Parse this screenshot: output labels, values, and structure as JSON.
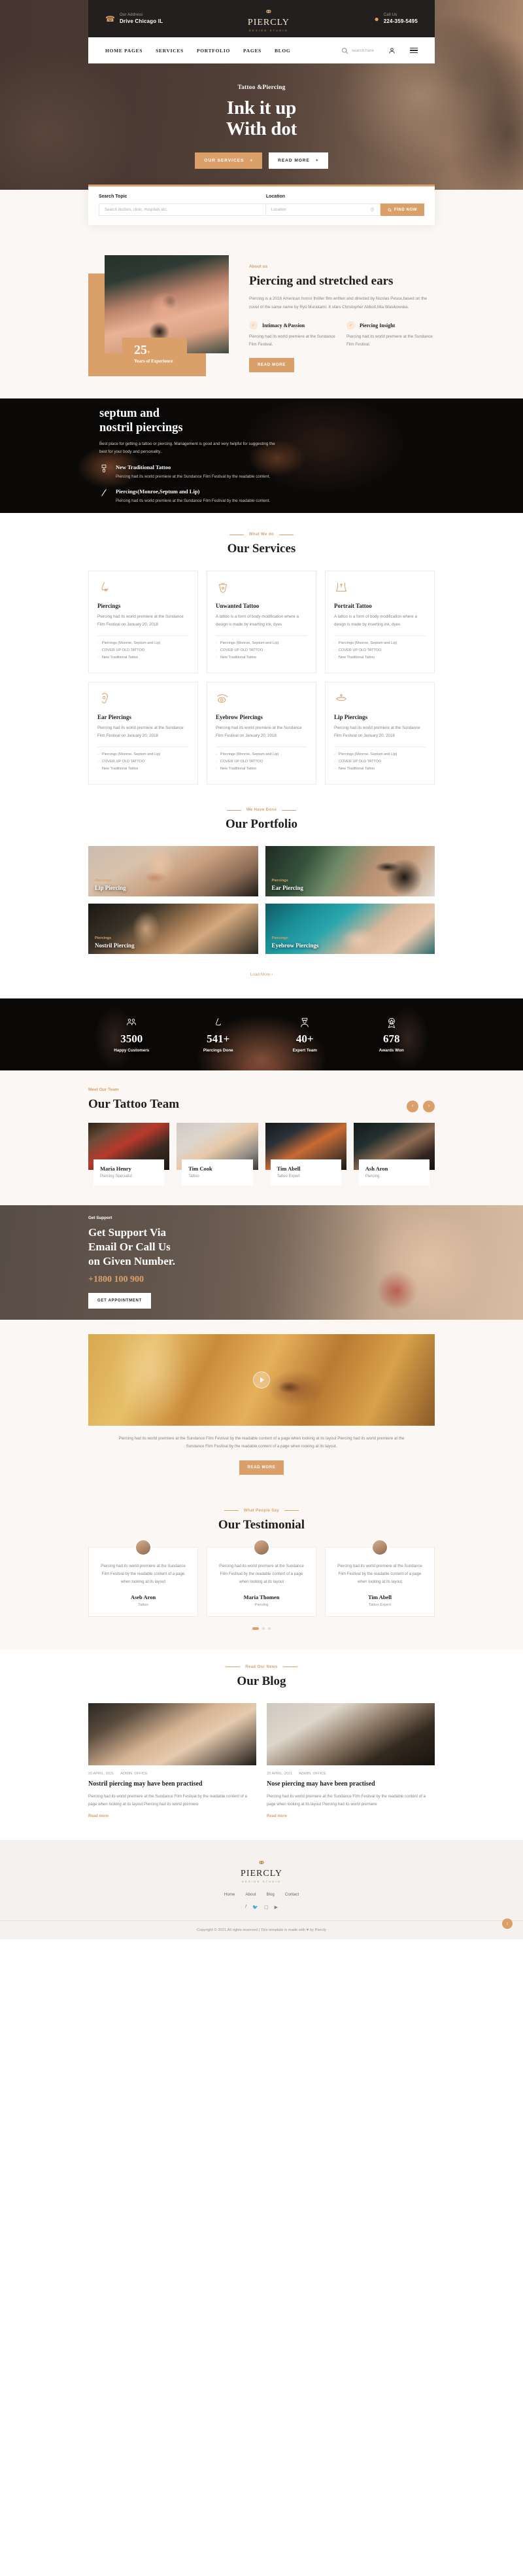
{
  "topbar": {
    "address_label": "Our Address",
    "address_value": "Drive Chicago IL",
    "call_label": "Call Us",
    "call_value": "224-359-5495",
    "logo_main": "PIERCLY",
    "logo_sub": "DESIGN  STUDIO"
  },
  "nav": {
    "items": [
      "HOME PAGES",
      "SERVICES",
      "PORTFOLIO",
      "PAGES",
      "BLOG"
    ],
    "search_placeholder": "search here"
  },
  "hero": {
    "subtitle": "Tattoo &Piercing",
    "title_line1": "Ink it up",
    "title_line2": "With dot",
    "btn_primary": "OUR SERVICES",
    "btn_secondary": "READ MORE"
  },
  "search": {
    "topic_label": "Search Topic",
    "topic_placeholder": "Search doctors, clinic, Hospitals etc.",
    "location_label": "Location",
    "location_placeholder": "Location",
    "find_button": "FIND NOW"
  },
  "about": {
    "eyebrow": "About us",
    "title": "Piercing and stretched ears",
    "paragraph": "Piercing is a 2018 American horror thriller film written and directed by Nicolas Pesce,based on the novel of the same name by Ryû Murakami. It stars Christopher Abbott,Mia Wasikowska.",
    "features": [
      {
        "title": "Intimacy &Passion",
        "text": "Piercing had its world premiere at the Sundance Film Festival."
      },
      {
        "title": "Piercing Insight",
        "text": "Piercing had its world premiere at the Sundance Film Festival."
      }
    ],
    "button": "READ MORE",
    "badge_number": "25",
    "badge_plus": "+",
    "badge_text": "Years of Experience"
  },
  "septum": {
    "title_line1": "septum and",
    "title_line2": "nostril piercings",
    "paragraph": "Best place for getting a tattoo or piercing. Management is good and very helpful for suggesting the best for your body and personality..",
    "items": [
      {
        "title": "New Traditional Tattoo",
        "text": "Piercing had its world premiere at the Sundance Film Festival by the readable content."
      },
      {
        "title": "Piercings(Monroe,Septum and Lip)",
        "text": "Piercing had its world premiere at the Sundance Film Festival by the readable content."
      }
    ]
  },
  "services": {
    "kicker": "What We do",
    "title": "Our Services",
    "cards": [
      {
        "icon": "nose-piercing-icon",
        "title": "Piercings",
        "text": "Piercing had its world premiere at the Sundance Film Festival on January 20, 2018",
        "links": [
          "Piercings (Monroe, Septum and Lip)",
          "COVER UP OLD TATTOO",
          "New Traditional Tattoo"
        ]
      },
      {
        "icon": "tongue-piercing-icon",
        "title": "Unwanted Tattoo",
        "text": "A tattoo is a form of body modification where a design is made by inserting ink, dyes",
        "links": [
          "Piercings (Monroe, Septum and Lip)",
          "COVER UP OLD TATTOO",
          "New Traditional Tattoo"
        ]
      },
      {
        "icon": "navel-piercing-icon",
        "title": "Portrait Tattoo",
        "text": "A tattoo is a form of body modification where a design is made by inserting ink, dyes",
        "links": [
          "Piercings (Monroe, Septum and Lip)",
          "COVER UP OLD TATTOO",
          "New Traditional Tattoo"
        ]
      },
      {
        "icon": "ear-piercing-icon",
        "title": "Ear Piercings",
        "text": "Piercing had its world premiere at the Sundance Film Festival on January 20, 2018",
        "links": [
          "Piercings (Monroe, Septum and Lip)",
          "COVER UP OLD TATTOO",
          "New Traditional Tattoo"
        ]
      },
      {
        "icon": "eyebrow-piercing-icon",
        "title": "Eyebrow Piercings",
        "text": "Piercing had its world premiere at the Sundance Film Festival on January 20, 2018",
        "links": [
          "Piercings (Monroe, Septum and Lip)",
          "COVER UP OLD TATTOO",
          "New Traditional Tattoo"
        ]
      },
      {
        "icon": "lip-piercing-icon",
        "title": "Lip Piercings",
        "text": "Piercing had its world premiere at the Sundance Film Festival on January 20, 2018",
        "links": [
          "Piercings (Monroe, Septum and Lip)",
          "COVER UP OLD TATTOO",
          "New Traditional Tattoo"
        ]
      }
    ]
  },
  "portfolio": {
    "kicker": "We Have Done",
    "title": "Our Portfolio",
    "items": [
      {
        "category": "Piercings",
        "title": "Lip Piercing"
      },
      {
        "category": "Piercings",
        "title": "Ear Piercing"
      },
      {
        "category": "Piercings",
        "title": "Nostril Piercing"
      },
      {
        "category": "Piercings",
        "title": "Eyebrow Piercings"
      }
    ],
    "load_more": "Load More"
  },
  "counters": [
    {
      "icon": "customers-icon",
      "number": "3500",
      "label": "Happy Customers"
    },
    {
      "icon": "nose-icon",
      "number": "541+",
      "label": "Piercings Done"
    },
    {
      "icon": "expert-icon",
      "number": "40+",
      "label": "Expert Team"
    },
    {
      "icon": "award-icon",
      "number": "678",
      "label": "Awards Won"
    }
  ],
  "team": {
    "kicker": "Meet Our Team",
    "title": "Our Tattoo Team",
    "members": [
      {
        "name": "Maria Henry",
        "role": "Piercing Specialist"
      },
      {
        "name": "Tim Cook",
        "role": "Tattoo"
      },
      {
        "name": "Tim Abell",
        "role": "Tattoo Expert"
      },
      {
        "name": "Ash Aron",
        "role": "Piercing"
      }
    ]
  },
  "cta": {
    "kicker": "Get Support",
    "title_line1": "Get Support Via",
    "title_line2": "Email Or Call Us",
    "title_line3": "on Given Number.",
    "phone": "+1800 100 900",
    "button": "GET APPOINTMENT"
  },
  "video": {
    "caption": "Piercing had its world premiere at the Sundance Film Festival by the readable content of a page when looking at its layout Piercing had its world premiere at the Sundance Film Festival by the readable content of a page when looking at its layout.",
    "button": "READ MORE"
  },
  "testimonial": {
    "kicker": "What People Say",
    "title": "Our Testimonial",
    "cards": [
      {
        "text": "Piercing had its world premiere at the Sundance Film Festival by the readable content of a page when looking at its layout",
        "name": "Aseb Aron",
        "role": "Tattoo"
      },
      {
        "text": "Piercing had its world premiere at the Sundance Film Festival by the readable content of a page when looking at its layout",
        "name": "Maria Thomen",
        "role": "Piercing"
      },
      {
        "text": "Piercing had its world premiere at the Sundance Film Festival by the readable content of a page when looking at its layout",
        "name": "Tim Abell",
        "role": "Tattoo Expert"
      }
    ]
  },
  "blog": {
    "kicker": "Read Our News",
    "title": "Our Blog",
    "posts": [
      {
        "date": "20 APRIL, 2021",
        "author": "ADMIN, OFFICE",
        "title": "Nostril piercing may have been practised",
        "text": "Piercing had its world premiere at the Sundance Film Festival by the readable content of a page when looking at its layout Piercing had its world premiere",
        "more": "Read more"
      },
      {
        "date": "20 APRIL, 2021",
        "author": "ADMIN, OFFICE",
        "title": "Nose piercing may have been practised",
        "text": "Piercing had its world premiere at the Sundance Film Festival by the readable content of a page when looking at its layout Piercing had its world premiere",
        "more": "Read more"
      }
    ]
  },
  "footer": {
    "logo_main": "PIERCLY",
    "logo_sub": "DESIGN  STUDIO",
    "links": [
      "Home",
      "About",
      "Blog",
      "Contact"
    ],
    "socials": [
      "facebook-icon",
      "twitter-icon",
      "instagram-icon",
      "youtube-icon"
    ],
    "copyright": "Copyright © 2021 All rights reserved | This template is made with ♥ by Piercly"
  },
  "colors": {
    "accent": "#dba06a",
    "dark": "#221f1e",
    "light": "#faf7f4"
  }
}
